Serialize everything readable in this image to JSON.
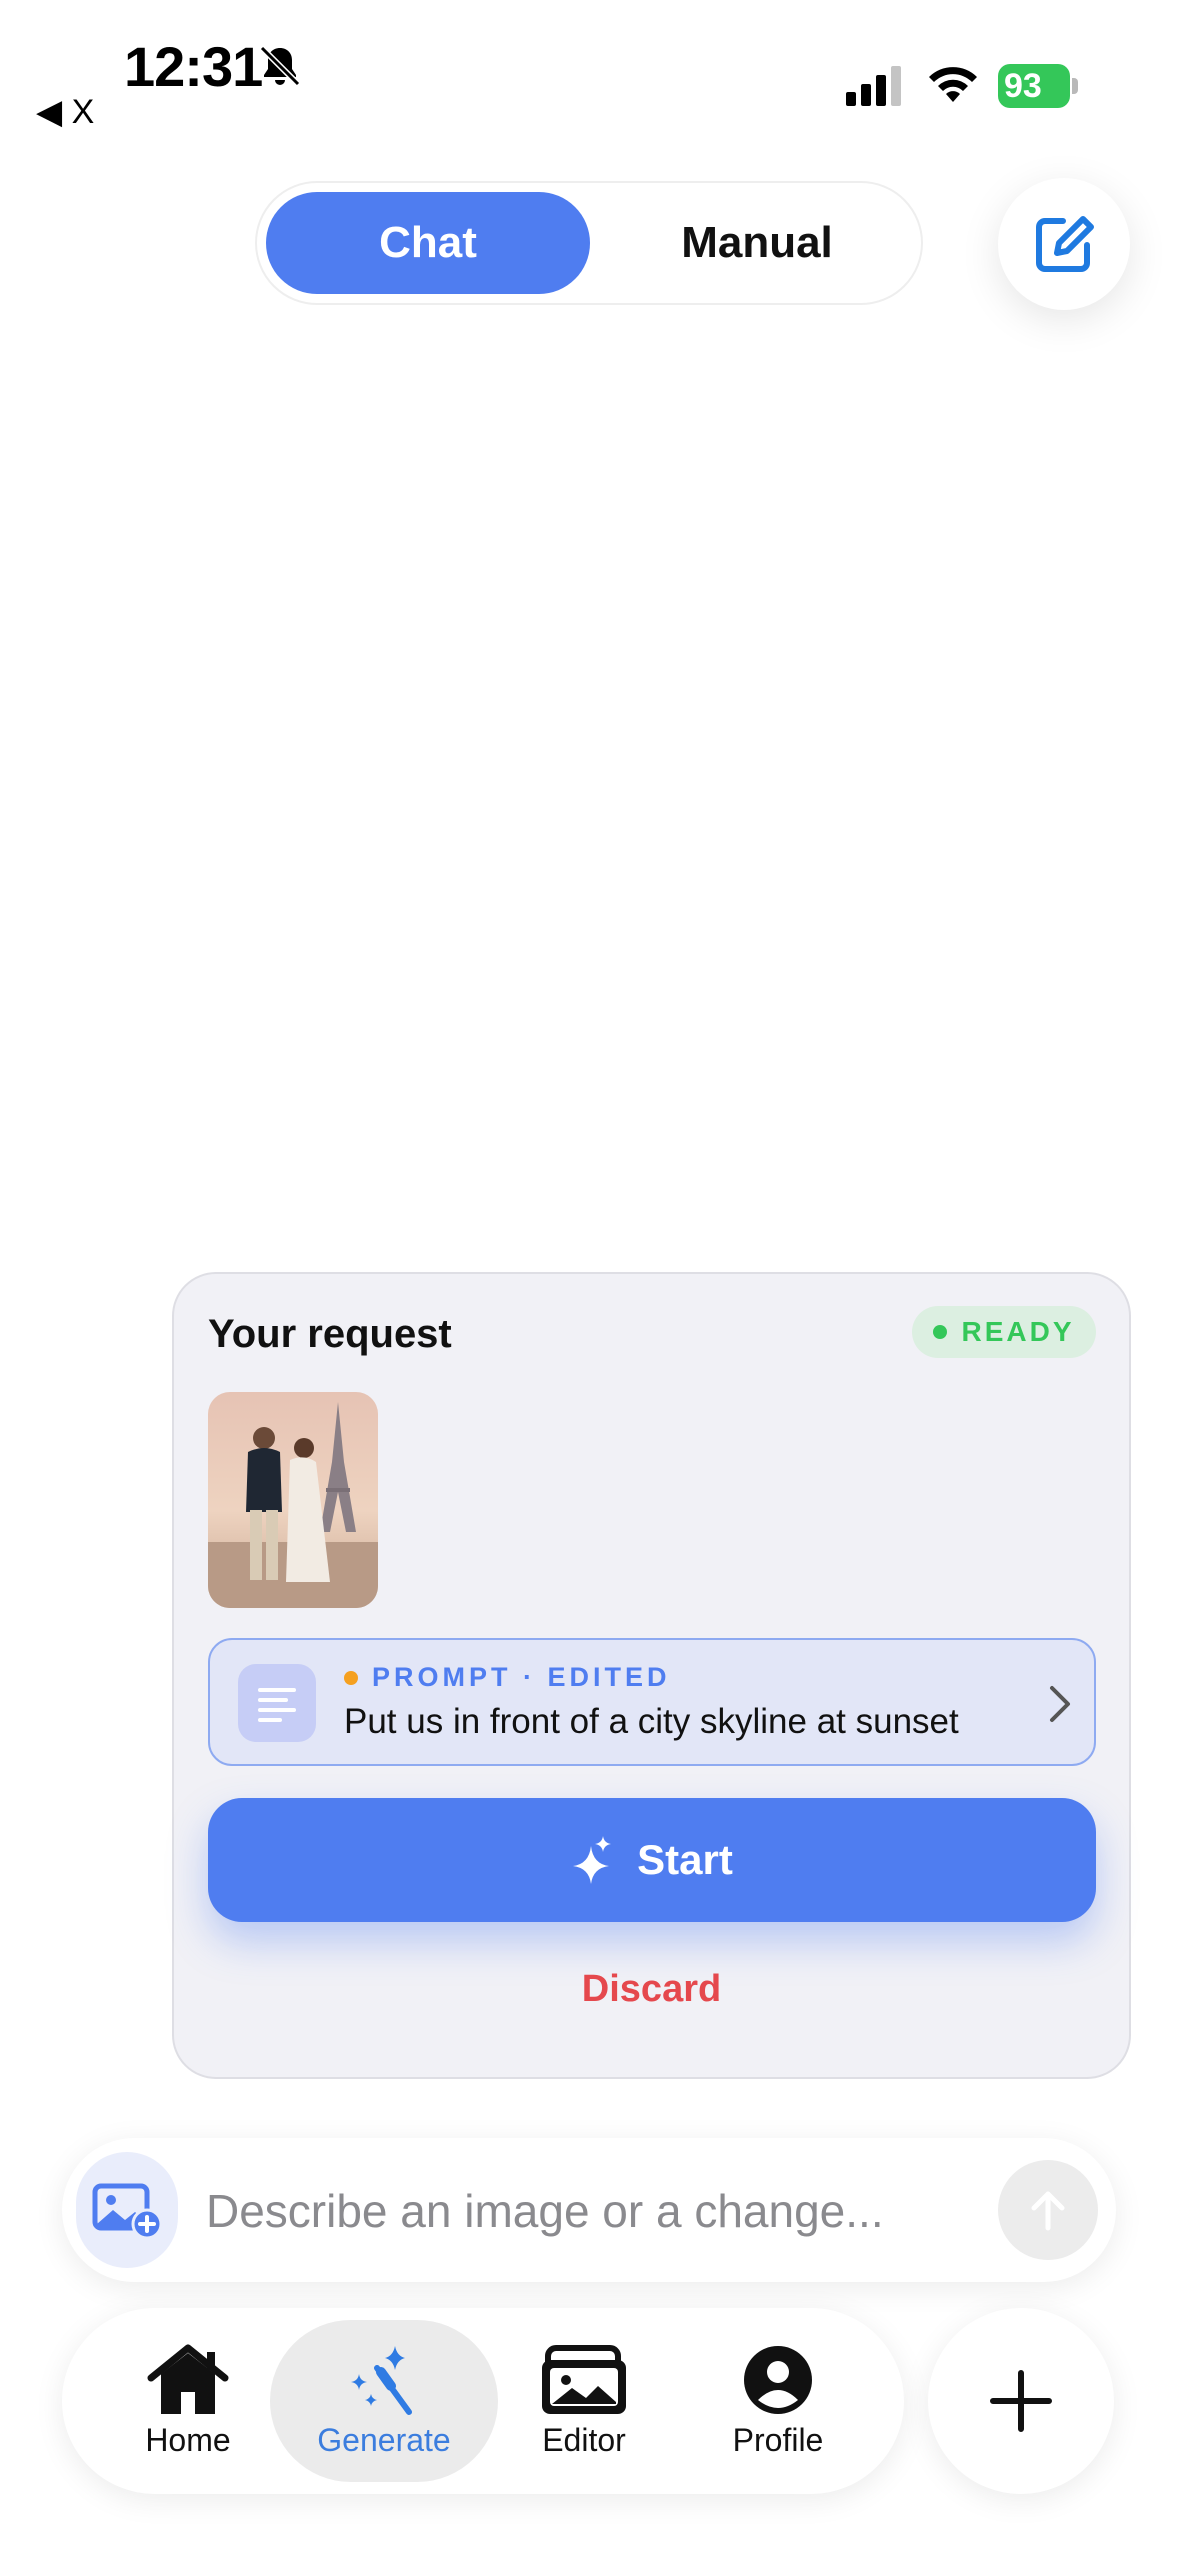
{
  "status_bar": {
    "time": "12:31",
    "back_label": "◀ X",
    "battery_level": "93"
  },
  "mode_switch": {
    "options": [
      "Chat",
      "Manual"
    ],
    "selected": "Chat"
  },
  "request_card": {
    "title": "Your request",
    "status": "READY",
    "prompt": {
      "label": "PROMPT · EDITED",
      "text": "Put us in front of a city skyline at sunset"
    },
    "start_label": "Start",
    "discard_label": "Discard"
  },
  "composer": {
    "placeholder": "Describe an image or a change..."
  },
  "tabbar": {
    "tabs": [
      {
        "label": "Home"
      },
      {
        "label": "Generate"
      },
      {
        "label": "Editor"
      },
      {
        "label": "Profile"
      }
    ],
    "active": "Generate"
  },
  "colors": {
    "accent": "#4f7df0",
    "ready": "#34c759",
    "discard": "#e5484d",
    "edited_dot": "#f5a020",
    "battery": "#34c759"
  },
  "icons": [
    "bell-slash-icon",
    "signal-icon",
    "wifi-icon",
    "battery-icon",
    "compose-icon",
    "lines-icon",
    "chevron-right-icon",
    "sparkle-icon",
    "add-image-icon",
    "arrow-up-icon",
    "home-icon",
    "magic-wand-icon",
    "photos-icon",
    "person-icon",
    "plus-icon"
  ]
}
